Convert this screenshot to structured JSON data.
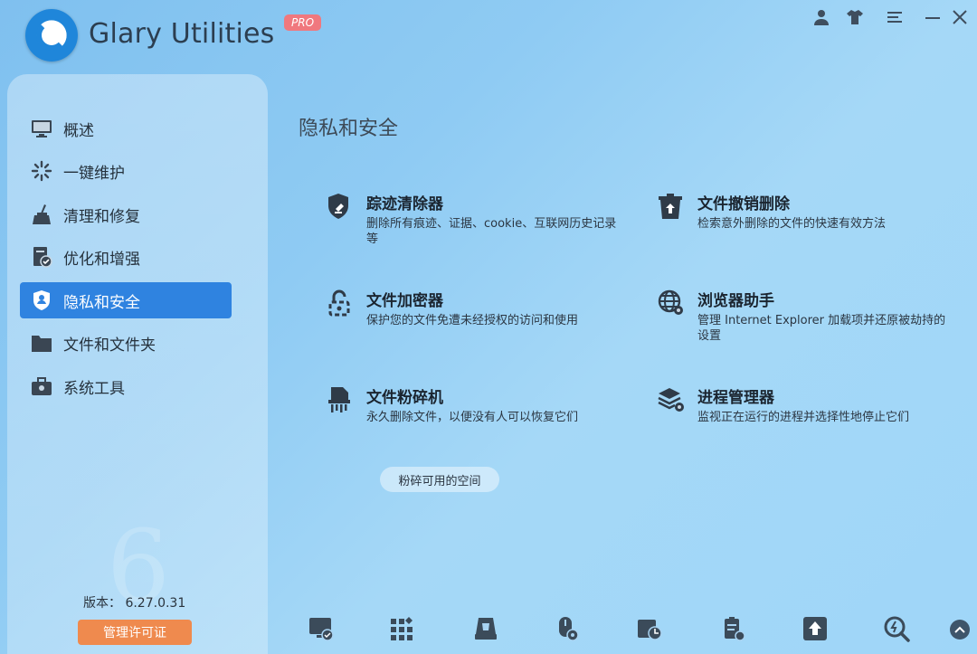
{
  "app": {
    "title": "Glary Utilities",
    "badge": "PRO"
  },
  "window_controls": [
    "user-icon",
    "skin-icon",
    "menu-icon",
    "minimize-icon",
    "close-icon"
  ],
  "sidebar": {
    "items": [
      {
        "label": "概述",
        "icon": "monitor-icon"
      },
      {
        "label": "一键维护",
        "icon": "sparkle-icon"
      },
      {
        "label": "清理和修复",
        "icon": "broom-icon"
      },
      {
        "label": "优化和增强",
        "icon": "optimize-icon"
      },
      {
        "label": "隐私和安全",
        "icon": "shield-user-icon",
        "active": true
      },
      {
        "label": "文件和文件夹",
        "icon": "folder-icon"
      },
      {
        "label": "系统工具",
        "icon": "toolbox-icon"
      }
    ],
    "version_label": "版本： 6.27.0.31",
    "license_button": "管理许可证"
  },
  "main": {
    "title": "隐私和安全",
    "tools": [
      {
        "name": "踪迹清除器",
        "desc": "删除所有痕迹、证据、cookie、互联网历史记录等",
        "icon": "trace-eraser-icon"
      },
      {
        "name": "文件撤销删除",
        "desc": "检索意外删除的文件的快速有效方法",
        "icon": "file-undelete-icon"
      },
      {
        "name": "文件加密器",
        "desc": "保护您的文件免遭未经授权的访问和使用",
        "icon": "file-encrypt-icon"
      },
      {
        "name": "浏览器助手",
        "desc": "管理 Internet Explorer 加载项并还原被劫持的设置",
        "icon": "browser-assistant-icon"
      },
      {
        "name": "文件粉碎机",
        "desc": "永久删除文件，以便没有人可以恢复它们",
        "icon": "file-shredder-icon"
      },
      {
        "name": "进程管理器",
        "desc": "监视正在运行的进程并选择性地停止它们",
        "icon": "process-manager-icon"
      }
    ],
    "free_space_button": "粉碎可用的空间"
  },
  "bottom_toolbar": [
    "disk-cleaner-icon",
    "registry-icon",
    "shortcut-icon",
    "memory-icon",
    "startup-icon",
    "uninstall-icon",
    "update-icon",
    "search-icon"
  ],
  "colors": {
    "accent": "#2f83e0",
    "license_button": "#ef8a4e",
    "badge": "#f0787e"
  }
}
